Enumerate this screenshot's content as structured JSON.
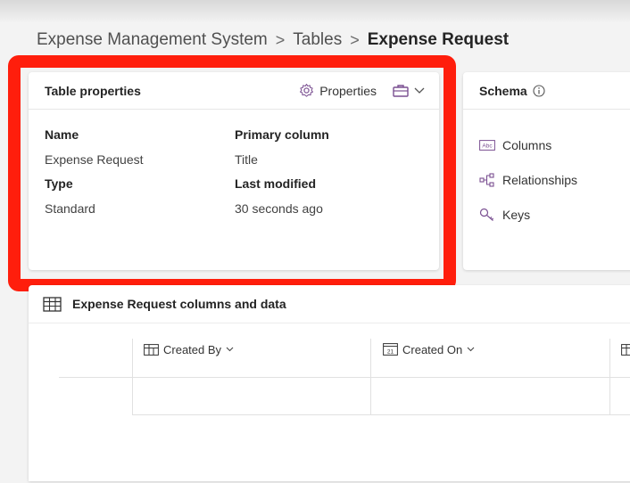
{
  "breadcrumb": {
    "items": [
      "Expense Management System",
      "Tables",
      "Expense Request"
    ]
  },
  "table_properties": {
    "title": "Table properties",
    "properties_button": "Properties",
    "fields": {
      "name_label": "Name",
      "name_value": "Expense Request",
      "primary_label": "Primary column",
      "primary_value": "Title",
      "type_label": "Type",
      "type_value": "Standard",
      "modified_label": "Last modified",
      "modified_value": "30 seconds ago"
    }
  },
  "schema": {
    "title": "Schema",
    "items": [
      {
        "label": "Columns",
        "icon": "text-column-icon"
      },
      {
        "label": "Relationships",
        "icon": "relationships-icon"
      },
      {
        "label": "Keys",
        "icon": "key-icon"
      }
    ]
  },
  "data_section": {
    "title": "Expense Request columns and data",
    "columns": [
      {
        "label": "Created By",
        "icon": "lookup-column-icon"
      },
      {
        "label": "Created On",
        "icon": "calendar-icon"
      }
    ]
  },
  "colors": {
    "highlight": "#ff1e0c",
    "icon_purple": "#7a4f91",
    "background": "#f3f3f3"
  }
}
